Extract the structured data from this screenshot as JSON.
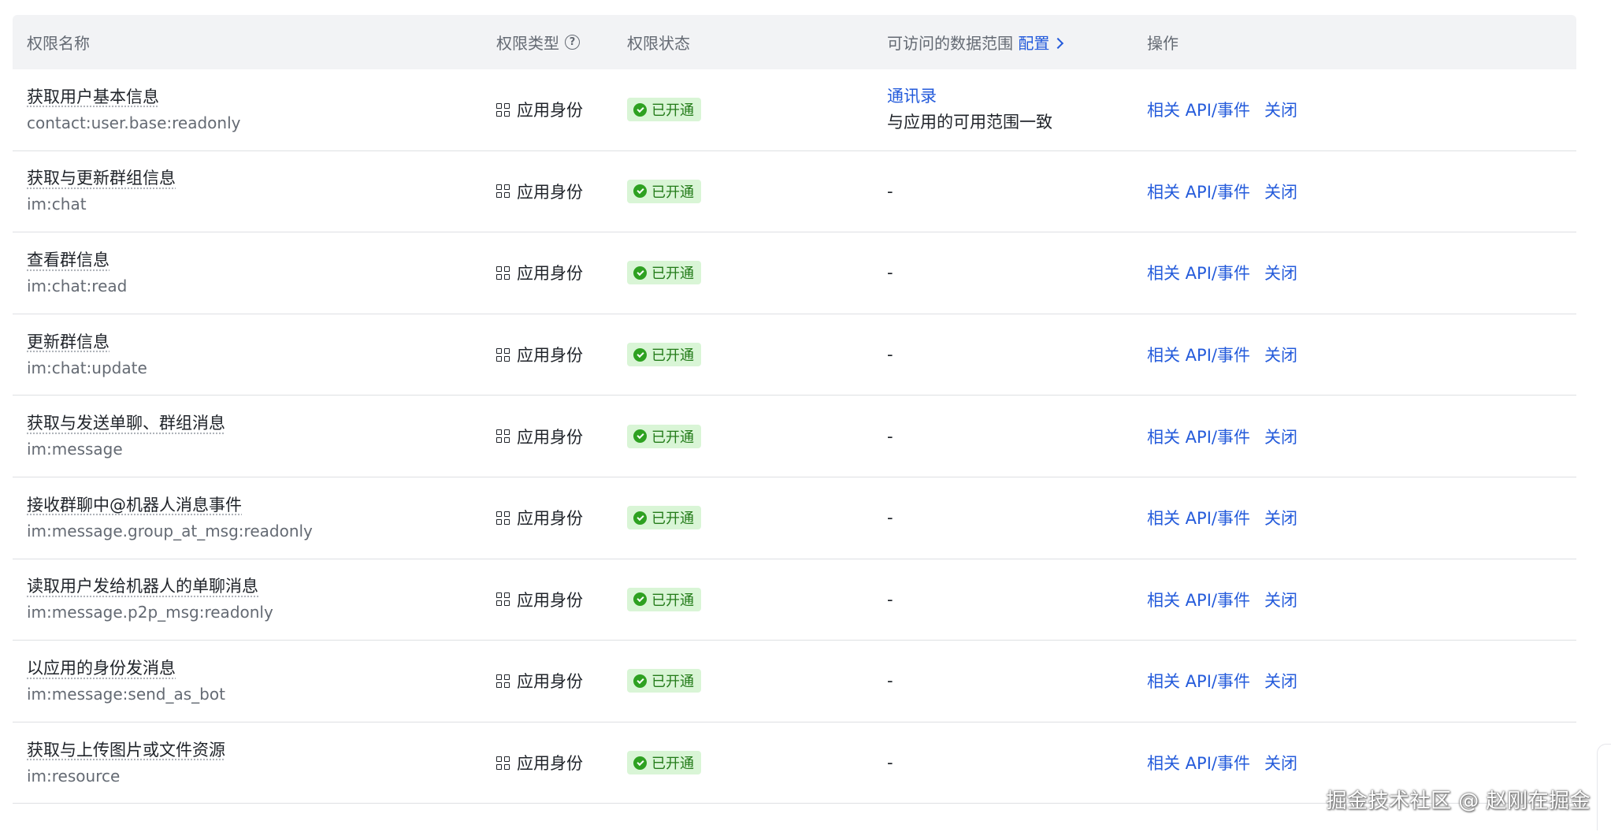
{
  "header": {
    "name": "权限名称",
    "type": "权限类型",
    "help_glyph": "?",
    "status": "权限状态",
    "range": "可访问的数据范围",
    "range_config": "配置",
    "ops": "操作"
  },
  "rows": [
    {
      "name": "获取用户基本信息",
      "scope": "contact:user.base:readonly",
      "type": "应用身份",
      "status": "已开通",
      "range_link": "通讯录",
      "range_text": "与应用的可用范围一致",
      "api": "相关 API/事件",
      "close": "关闭"
    },
    {
      "name": "获取与更新群组信息",
      "scope": "im:chat",
      "type": "应用身份",
      "status": "已开通",
      "range": "-",
      "api": "相关 API/事件",
      "close": "关闭"
    },
    {
      "name": "查看群信息",
      "scope": "im:chat:read",
      "type": "应用身份",
      "status": "已开通",
      "range": "-",
      "api": "相关 API/事件",
      "close": "关闭"
    },
    {
      "name": "更新群信息",
      "scope": "im:chat:update",
      "type": "应用身份",
      "status": "已开通",
      "range": "-",
      "api": "相关 API/事件",
      "close": "关闭"
    },
    {
      "name": "获取与发送单聊、群组消息",
      "scope": "im:message",
      "type": "应用身份",
      "status": "已开通",
      "range": "-",
      "api": "相关 API/事件",
      "close": "关闭"
    },
    {
      "name": "接收群聊中@机器人消息事件",
      "scope": "im:message.group_at_msg:readonly",
      "type": "应用身份",
      "status": "已开通",
      "range": "-",
      "api": "相关 API/事件",
      "close": "关闭"
    },
    {
      "name": "读取用户发给机器人的单聊消息",
      "scope": "im:message.p2p_msg:readonly",
      "type": "应用身份",
      "status": "已开通",
      "range": "-",
      "api": "相关 API/事件",
      "close": "关闭"
    },
    {
      "name": "以应用的身份发消息",
      "scope": "im:message:send_as_bot",
      "type": "应用身份",
      "status": "已开通",
      "range": "-",
      "api": "相关 API/事件",
      "close": "关闭"
    },
    {
      "name": "获取与上传图片或文件资源",
      "scope": "im:resource",
      "type": "应用身份",
      "status": "已开通",
      "range": "-",
      "api": "相关 API/事件",
      "close": "关闭"
    }
  ],
  "watermark": "掘金技术社区 @ 赵刚在掘金",
  "colors": {
    "link": "#245bdb",
    "badge_bg": "#d9f5d6",
    "badge_text": "#237b19",
    "header_bg": "#f2f3f5"
  }
}
